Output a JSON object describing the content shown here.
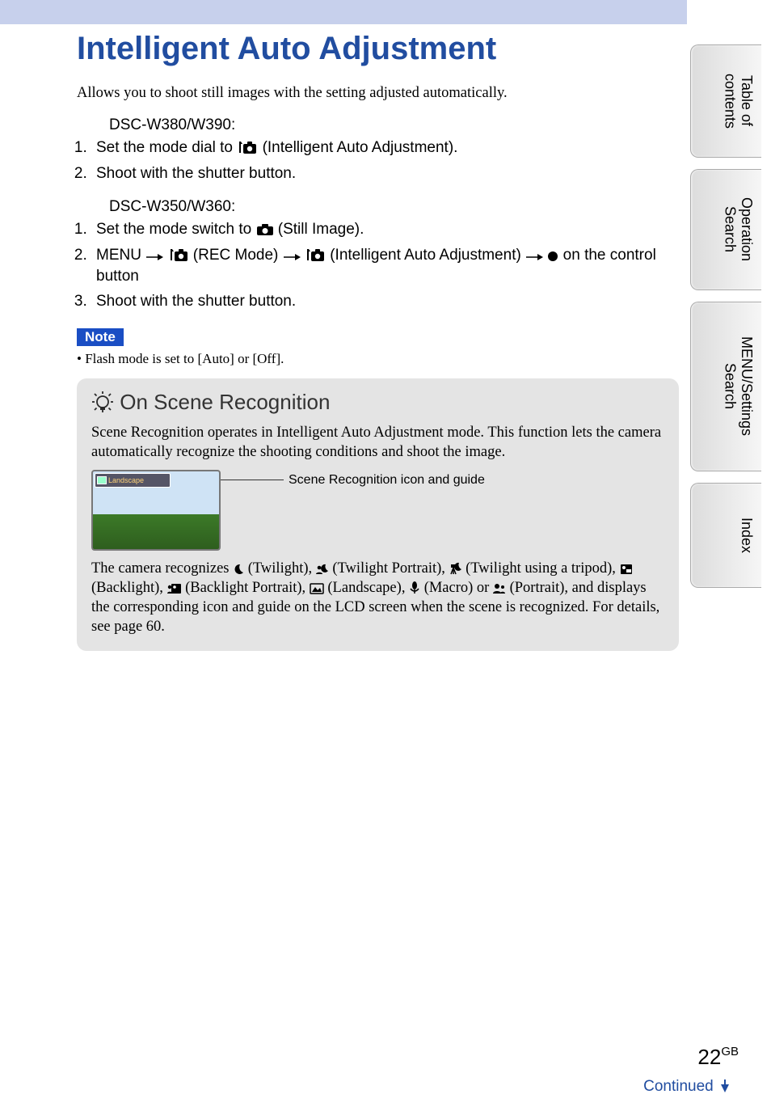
{
  "title": "Intelligent Auto Adjustment",
  "intro": "Allows you to shoot still images with the setting adjusted automatically.",
  "sectionA": {
    "model": "DSC-W380/W390:",
    "step1_a": "Set the mode dial to ",
    "step1_b": " (Intelligent Auto Adjustment).",
    "step2": "Shoot with the shutter button."
  },
  "sectionB": {
    "model": "DSC-W350/W360:",
    "step1_a": "Set the mode switch to ",
    "step1_b": " (Still Image).",
    "step2_a": "MENU ",
    "step2_b": " (REC Mode) ",
    "step2_c": " (Intelligent Auto Adjustment) ",
    "step2_d": " on the control button",
    "step3": "Shoot with the shutter button."
  },
  "note": {
    "label": "Note",
    "text": "Flash mode is set to [Auto] or [Off]."
  },
  "tip": {
    "title": "On Scene Recognition",
    "para1": "Scene Recognition operates in Intelligent Auto Adjustment mode. This function lets the camera automatically recognize the shooting conditions and shoot the image.",
    "callout": "Scene Recognition icon and guide",
    "lcd_label": "Landscape",
    "para2_lead": "The camera recognizes ",
    "scenes": [
      {
        "label": "(Twilight)"
      },
      {
        "label": "(Twilight Portrait)"
      },
      {
        "label": "(Twilight using a tripod)"
      },
      {
        "label": "(Backlight)"
      },
      {
        "label": "(Backlight Portrait)"
      },
      {
        "label": "(Landscape)"
      },
      {
        "label": "(Macro)"
      },
      {
        "label": "(Portrait)"
      }
    ],
    "joiner_or": " or ",
    "para2_tail": ", and displays the corresponding icon and guide on the LCD screen when the scene is recognized. For details, see page 60."
  },
  "tabs": [
    "Table of contents",
    "Operation Search",
    "MENU/Settings Search",
    "Index"
  ],
  "footer": {
    "page": "22",
    "gb": "GB",
    "continued": "Continued"
  }
}
